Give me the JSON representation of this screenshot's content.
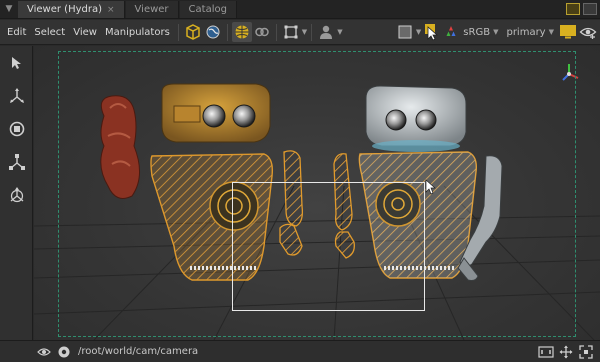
{
  "tabs": [
    {
      "label": "Viewer (Hydra)",
      "active": true
    },
    {
      "label": "Viewer",
      "active": false
    },
    {
      "label": "Catalog",
      "active": false
    }
  ],
  "tab_close_symbol": "×",
  "menu": {
    "edit": "Edit",
    "select": "Select",
    "view": "View",
    "manipulators": "Manipulators"
  },
  "toolbar": {
    "colorspace": "sRGB",
    "display": "primary"
  },
  "status": {
    "camera_path": "/root/world/cam/camera"
  },
  "icons": {
    "tab_menu": "tab-menu-icon",
    "cube": "cube-icon",
    "globe": "globe-icon",
    "grid": "grid-sphere-icon",
    "link": "link-icon",
    "frame": "frame-icon",
    "person": "person-icon",
    "shading": "shading-icon",
    "highlight": "pointer-highlight-icon",
    "rgb": "rgb-icon",
    "monitor": "monitor-icon",
    "eye": "eye-hidden-icon",
    "select_tool": "select-arrow-icon",
    "translate_tool": "translate-icon",
    "rotate_tool": "rotate-icon",
    "scale_tool": "scale-icon",
    "transform_tool": "transform-icon",
    "axis_gizmo": "axis-gizmo-icon"
  },
  "colors": {
    "accent_yellow": "#d8b020",
    "frame_green": "#2f8f6f",
    "outline_orange": "#e09a2c"
  }
}
